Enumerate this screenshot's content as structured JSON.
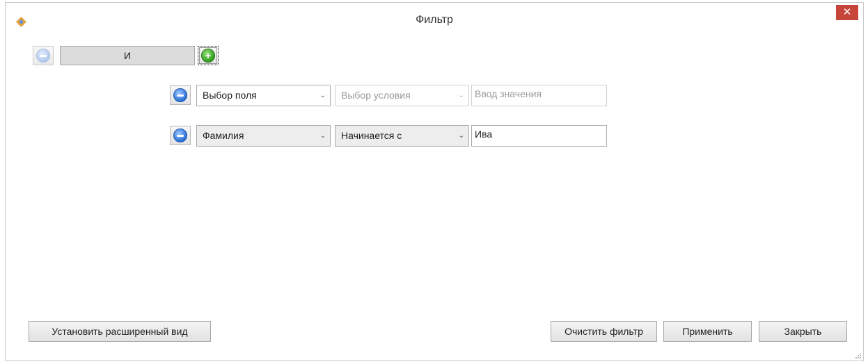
{
  "window": {
    "title": "Фильтр",
    "close_symbol": "✕"
  },
  "group": {
    "logic_label": "И"
  },
  "conditions": [
    {
      "field": "Выбор поля",
      "condition": "Выбор условия",
      "value": "",
      "value_placeholder": "Ввод значения"
    },
    {
      "field": "Фамилия",
      "condition": "Начинается с",
      "value": "Ива",
      "value_placeholder": ""
    }
  ],
  "footer": {
    "advanced_label": "Установить расширенный вид",
    "clear_label": "Очистить фильтр",
    "apply_label": "Применить",
    "close_label": "Закрыть"
  },
  "icons": {
    "app": "settings-gear-icon",
    "remove": "minus-circle-icon",
    "add": "plus-circle-icon",
    "dropdown": "chevron-down-icon",
    "resize": "resize-grip-icon"
  },
  "colors": {
    "close_button": "#c7453a",
    "remove_icon": "#2a6fd6",
    "add_icon": "#2f9d1e"
  }
}
